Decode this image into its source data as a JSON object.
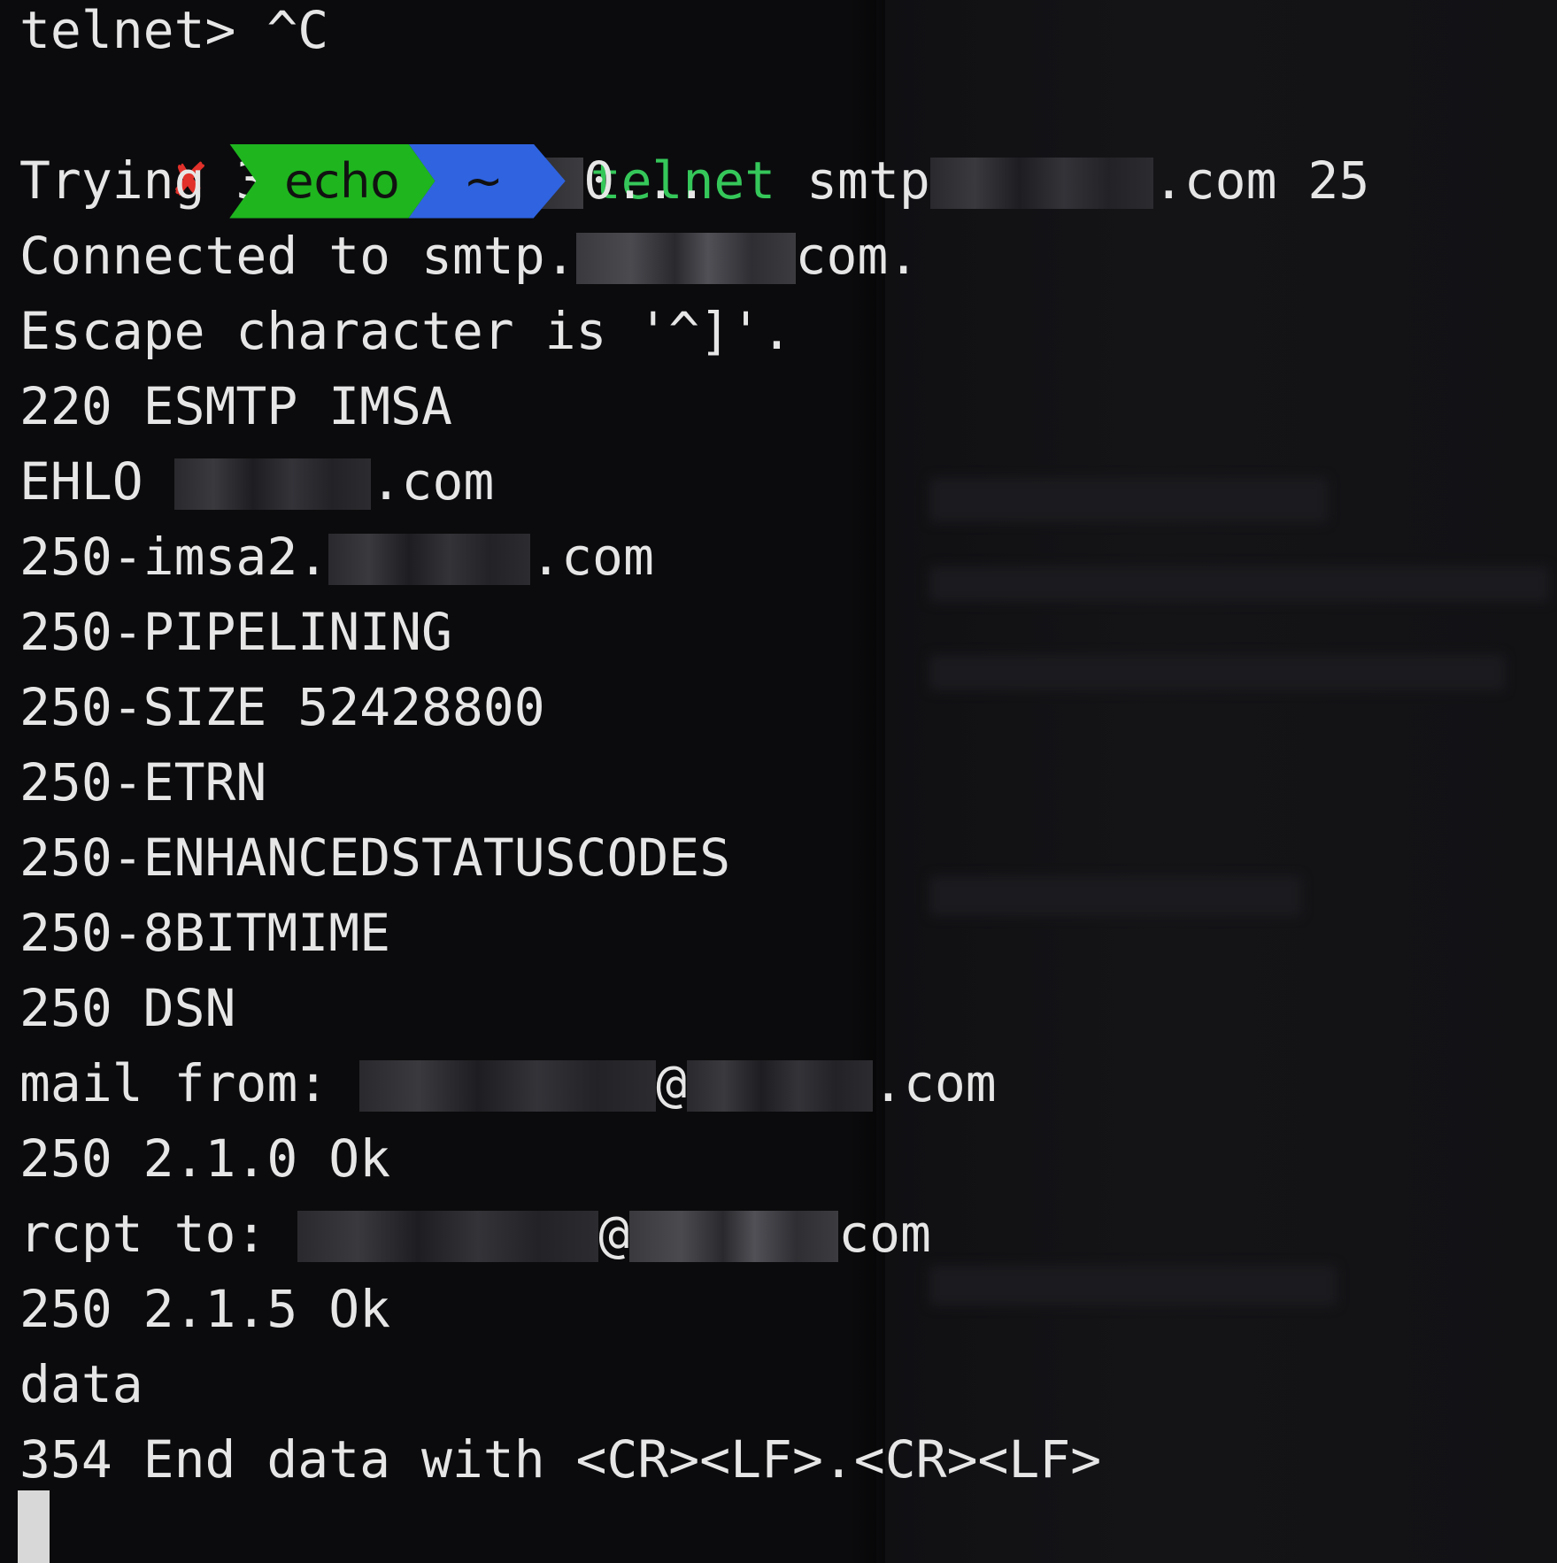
{
  "terminal": {
    "prev_line": "telnet> ^C",
    "prompt": {
      "status_icon": "x-mark-icon",
      "status_color": "#e2302a",
      "user": "echo",
      "user_bg": "#1fb51f",
      "dir": "~",
      "dir_bg": "#2f63e0"
    },
    "command": {
      "name": "telnet",
      "arg_prefix": "smtp",
      "arg_suffix": ".com 25"
    },
    "lines": {
      "trying_prefix": "Trying 36.",
      "trying_suffix": "0...",
      "connected_prefix": "Connected to smtp.",
      "connected_suffix": "com.",
      "escape": "Escape character is '^]'.",
      "banner": "220 ESMTP IMSA",
      "ehlo_prefix": "EHLO ",
      "ehlo_suffix": ".com",
      "resp_host_prefix": "250-imsa2.",
      "resp_host_suffix": ".com",
      "resp_pipelining": "250-PIPELINING",
      "resp_size": "250-SIZE 52428800",
      "resp_etrn": "250-ETRN",
      "resp_enhanced": "250-ENHANCEDSTATUSCODES",
      "resp_8bit": "250-8BITMIME",
      "resp_dsn": "250 DSN",
      "mail_from_prefix": "mail from: ",
      "mail_from_at": "@",
      "mail_from_suffix": ".com",
      "mail_ok": "250 2.1.0 Ok",
      "rcpt_prefix": "rcpt to: ",
      "rcpt_at": "@",
      "rcpt_suffix": "com",
      "rcpt_ok": "250 2.1.5 Ok",
      "data_cmd": "data",
      "data_resp": "354 End data with <CR><LF>.<CR><LF>"
    }
  }
}
